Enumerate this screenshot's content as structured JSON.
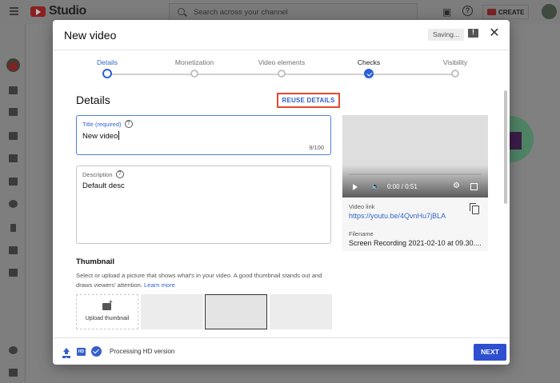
{
  "app": {
    "brand": "Studio",
    "search_placeholder": "Search across your channel",
    "create_label": "CREATE"
  },
  "modal": {
    "title": "New video",
    "saving_label": "Saving...",
    "steps": [
      {
        "label": "Details",
        "state": "active"
      },
      {
        "label": "Monetization",
        "state": "pending"
      },
      {
        "label": "Video elements",
        "state": "pending"
      },
      {
        "label": "Checks",
        "state": "complete"
      },
      {
        "label": "Visibility",
        "state": "pending"
      }
    ],
    "section_heading": "Details",
    "reuse_label": "REUSE DETAILS",
    "title_field": {
      "label": "Title (required)",
      "value": "New video",
      "count": "9/100"
    },
    "description_field": {
      "label": "Description",
      "value": "Default desc"
    },
    "thumbnail": {
      "heading": "Thumbnail",
      "text": "Select or upload a picture that shows what's in your video. A good thumbnail stands out and draws viewers' attention.",
      "learn_more": "Learn more",
      "upload_label": "Upload thumbnail"
    },
    "preview": {
      "time": "0:00 / 0:51",
      "link_label": "Video link",
      "link_value": "https://youtu.be/4QvnHu7jBLA",
      "file_label": "Filename",
      "file_value": "Screen Recording 2021-02-10 at 09.30...."
    },
    "footer": {
      "status": "Processing HD version",
      "hd_badge": "HD",
      "next_label": "NEXT"
    }
  },
  "colors": {
    "accent": "#2b5fd9",
    "highlight_border": "#e04a2f",
    "next_button": "#2e4fd0"
  }
}
